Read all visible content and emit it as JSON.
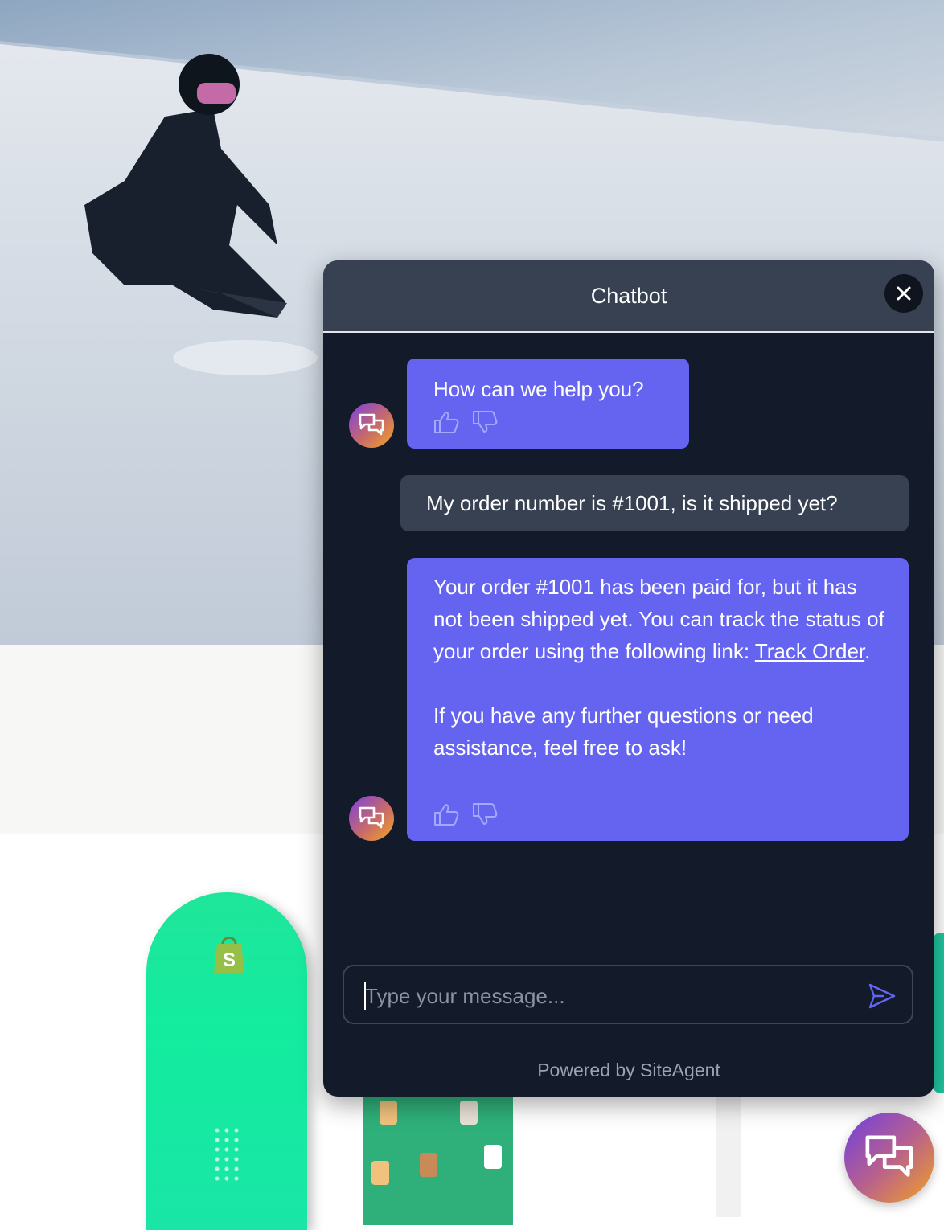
{
  "chat": {
    "title": "Chatbot",
    "messages": [
      {
        "role": "bot",
        "text": "How can we help you?"
      },
      {
        "role": "user",
        "text": "My order number is #1001, is it shipped yet?"
      },
      {
        "role": "bot",
        "text_before_link": "Your order #1001 has been paid for, but it has not been shipped yet. You can track the status of your order using the following link: ",
        "link_text": "Track Order",
        "text_after_link": ".",
        "followup": "If you have any further questions or need assistance, feel free to ask!"
      }
    ],
    "input_placeholder": "Type your message...",
    "footer": "Powered by SiteAgent"
  },
  "colors": {
    "bot_bubble": "#6464f0",
    "user_bubble": "#374151",
    "panel_bg": "#131a29",
    "header_bg": "#374151"
  },
  "icons": {
    "close": "close-icon",
    "thumbs_up": "thumbs-up-icon",
    "thumbs_down": "thumbs-down-icon",
    "send": "send-icon",
    "chat": "chat-bubbles-icon"
  }
}
